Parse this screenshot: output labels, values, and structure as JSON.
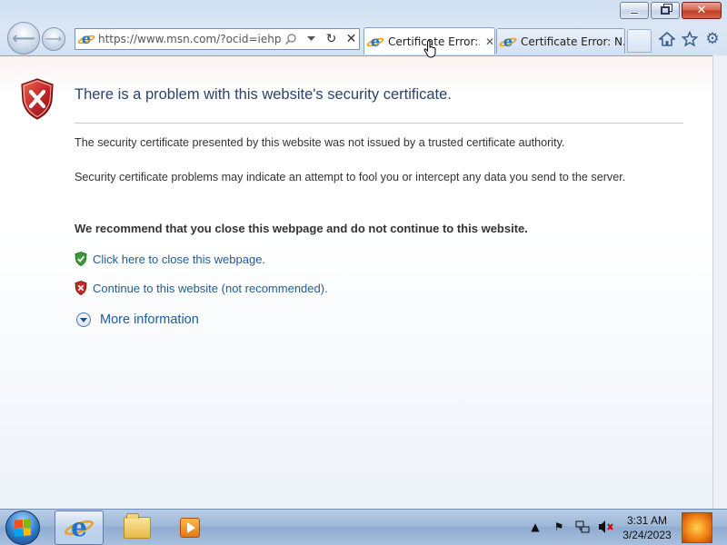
{
  "browser": {
    "address_url": "https://www.msn.com/?ocid=iehp",
    "tabs": [
      {
        "label": "Certificate Error:...",
        "active": true
      },
      {
        "label": "Certificate Error: N...",
        "active": false
      }
    ],
    "caption": {
      "minimize_icon": "minimize-icon",
      "restore_icon": "restore-icon",
      "close_glyph": "✕"
    }
  },
  "page": {
    "title": "There is a problem with this website's security certificate.",
    "para1": "The security certificate presented by this website was not issued by a trusted certificate authority.",
    "para2": "Security certificate problems may indicate an attempt to fool you or intercept any data you send to the server.",
    "recommend": "We recommend that you close this webpage and do not continue to this website.",
    "close_link": "Click here to close this webpage.",
    "continue_link": "Continue to this website (not recommended).",
    "more_info": "More information"
  },
  "colors": {
    "title": "#2c4468",
    "link": "#1f5b9b",
    "shield_red": "#c22a2a",
    "shield_green": "#3a9a3a"
  },
  "taskbar": {
    "clock_time": "3:31 AM",
    "clock_date": "3/24/2023"
  }
}
